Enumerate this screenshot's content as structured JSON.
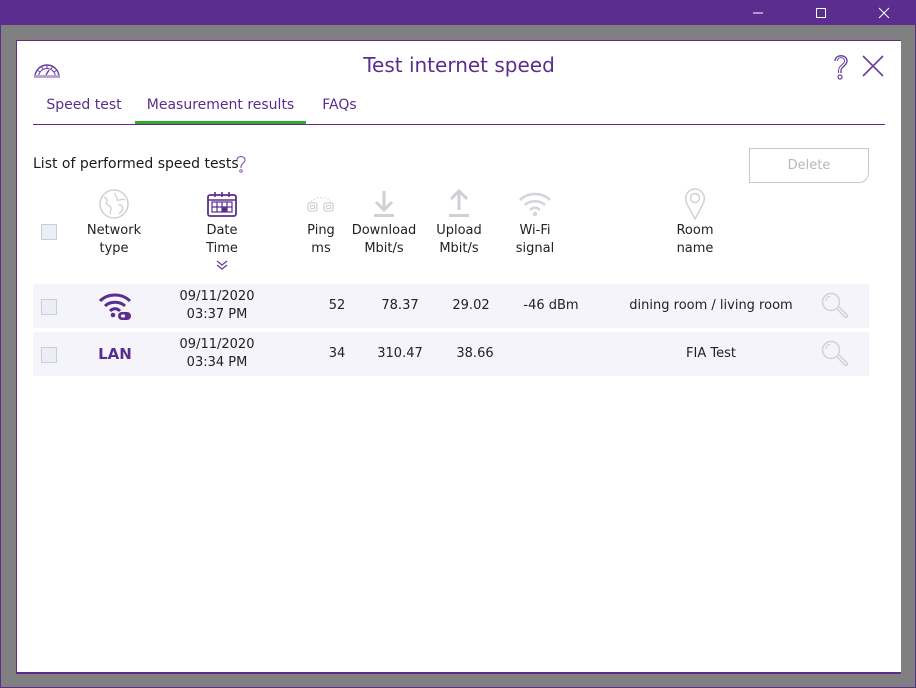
{
  "window": {
    "controls": {
      "minimize": "minimize",
      "maximize": "maximize",
      "close": "close"
    }
  },
  "dialog": {
    "title": "Test internet speed",
    "icons": {
      "app": "speedometer-icon",
      "help": "question-icon",
      "close": "close-icon"
    }
  },
  "tabs": [
    {
      "label": "Speed test",
      "active": false
    },
    {
      "label": "Measurement results",
      "active": true
    },
    {
      "label": "FAQs",
      "active": false
    }
  ],
  "list": {
    "title": "List of performed speed tests",
    "delete_label": "Delete",
    "delete_enabled": false
  },
  "columns": [
    {
      "line1": "Network",
      "line2": "type",
      "icon": "globe-icon"
    },
    {
      "line1": "Date",
      "line2": "Time",
      "icon": "calendar-icon",
      "sorted": "descending"
    },
    {
      "line1": "Ping",
      "line2": "ms",
      "icon": "ping-icon"
    },
    {
      "line1": "Download",
      "line2": "Mbit/s",
      "icon": "download-icon"
    },
    {
      "line1": "Upload",
      "line2": "Mbit/s",
      "icon": "upload-icon"
    },
    {
      "line1": "Wi-Fi",
      "line2": "signal",
      "icon": "wifi-icon"
    },
    {
      "line1": "Room",
      "line2": "name",
      "icon": "location-pin-icon"
    }
  ],
  "rows": [
    {
      "network_type": "Wi-Fi",
      "network_icon": "wifi-icon",
      "date": "09/11/2020",
      "time": "03:37 PM",
      "ping": "52",
      "download": "78.37",
      "upload": "29.02",
      "wifi_signal": "-46 dBm",
      "room": "dining room / living room",
      "checked": false
    },
    {
      "network_type": "LAN",
      "network_icon": "",
      "date": "09/11/2020",
      "time": "03:34 PM",
      "ping": "34",
      "download": "310.47",
      "upload": "38.66",
      "wifi_signal": "",
      "room": "FIA Test",
      "checked": false
    }
  ],
  "colors": {
    "brand": "#5b2d8e",
    "tab_indicator": "#2fa836",
    "row_bg": "#f4f4fa",
    "icon_inactive": "#d0d0d6"
  }
}
